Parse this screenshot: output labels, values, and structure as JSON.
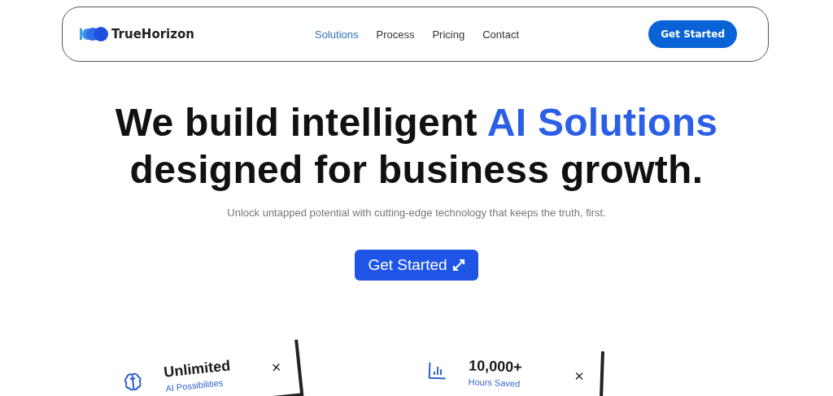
{
  "brand": {
    "name": "TrueHorizon"
  },
  "nav": [
    {
      "label": "Solutions",
      "selected": true
    },
    {
      "label": "Process",
      "selected": false
    },
    {
      "label": "Pricing",
      "selected": false
    },
    {
      "label": "Contact",
      "selected": false
    }
  ],
  "nav_button": "Get Started",
  "hero": {
    "headline_start": "We build intelligent ",
    "headline_highlight": "AI Solutions",
    "headline_end": "designed for business growth.",
    "subtitle": "Unlock untapped potential with cutting-edge technology that keeps the truth, first.",
    "button": "Get Started"
  },
  "cards": [
    {
      "kind": "brain",
      "title": "Unlimited",
      "caption": "AI Possibilities",
      "close": "×"
    },
    {
      "kind": "chart",
      "title": "10,000+",
      "caption": "Hours Saved",
      "close": "×"
    }
  ]
}
